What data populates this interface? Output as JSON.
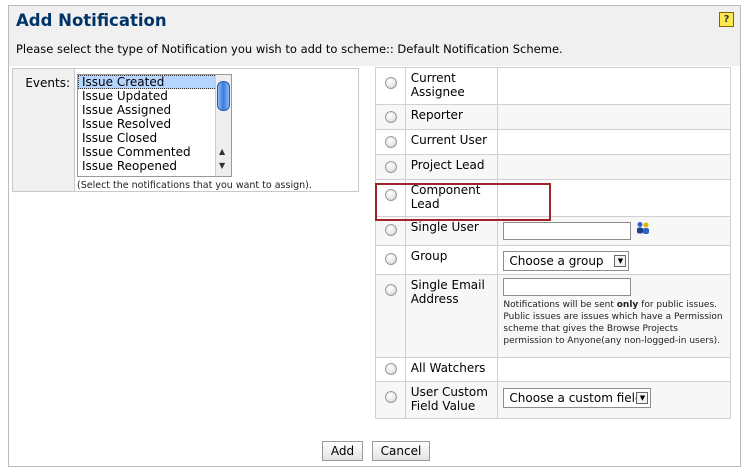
{
  "header": {
    "title": "Add Notification",
    "subtitle": "Please select the type of Notification you wish to add to scheme:: Default Notification Scheme.",
    "help_icon": "help-icon"
  },
  "events": {
    "label": "Events:",
    "options": [
      "Issue Created",
      "Issue Updated",
      "Issue Assigned",
      "Issue Resolved",
      "Issue Closed",
      "Issue Commented",
      "Issue Reopened"
    ],
    "selected": "Issue Created",
    "hint": "(Select the notifications that you want to assign)."
  },
  "types": {
    "current_assignee": "Current Assignee",
    "reporter": "Reporter",
    "current_user": "Current User",
    "project_lead": "Project Lead",
    "component_lead": "Component Lead",
    "single_user": "Single User",
    "group": "Group",
    "group_select": "Choose a group",
    "single_email": "Single Email Address",
    "email_note_pre": "Notifications will be sent ",
    "email_note_bold": "only",
    "email_note_post": " for public issues. Public issues are issues which have a Permission scheme that gives the Browse Projects permission to Anyone(any non-logged-in users).",
    "all_watchers": "All Watchers",
    "user_custom_field": "User Custom Field Value",
    "custom_field_select": "Choose a custom field"
  },
  "buttons": {
    "add": "Add",
    "cancel": "Cancel"
  }
}
